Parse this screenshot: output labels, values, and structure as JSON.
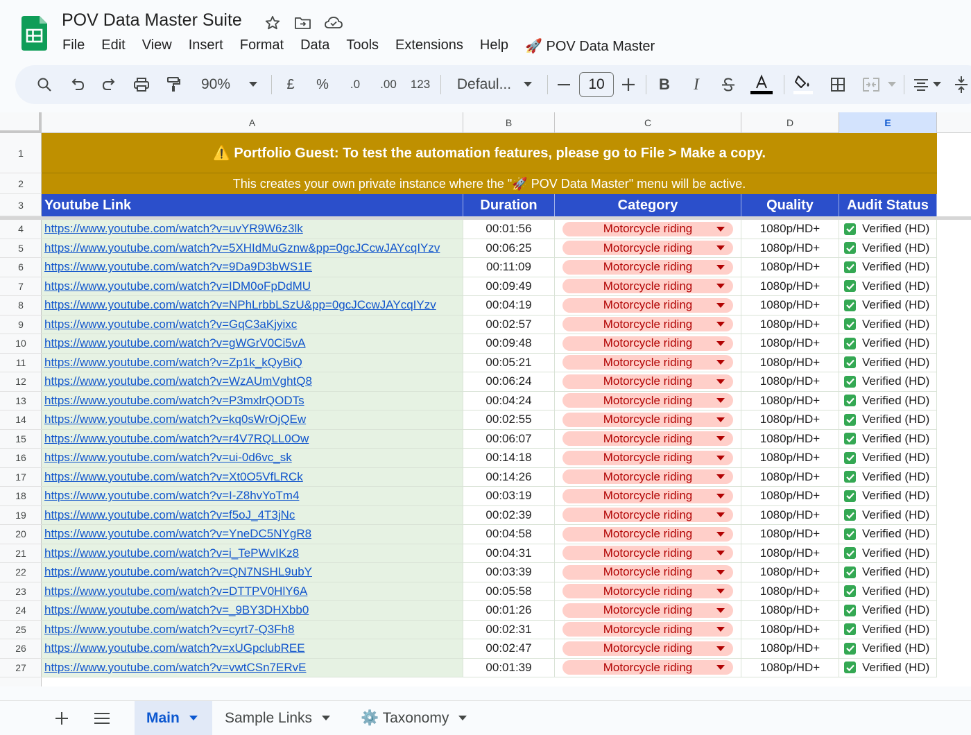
{
  "doc": {
    "title": "POV Data Master Suite"
  },
  "menu": [
    "File",
    "Edit",
    "View",
    "Insert",
    "Format",
    "Data",
    "Tools",
    "Extensions",
    "Help",
    "🚀 POV Data Master"
  ],
  "toolbar": {
    "zoom": "90%",
    "currency": "£",
    "percent": "%",
    "dec_decrease": ".0",
    "dec_increase": ".00",
    "number_format": "123",
    "font": "Defaul...",
    "font_size": "10"
  },
  "grid": {
    "columns": [
      "A",
      "B",
      "C",
      "D",
      "E"
    ],
    "selected_column": "E",
    "banner_line1": "⚠️ Portfolio Guest: To test the automation features, please go to File > Make a copy.",
    "banner_line2": "This creates your own private instance where the \"🚀 POV Data Master\" menu will be active.",
    "headers": [
      "Youtube Link",
      "Duration",
      "Category",
      "Quality",
      "Audit Status"
    ],
    "rows": [
      {
        "n": "4",
        "link": "https://www.youtube.com/watch?v=uvYR9W6z3lk",
        "duration": "00:01:56",
        "category": "Motorcycle riding",
        "quality": "1080p/HD+",
        "status": "Verified (HD)"
      },
      {
        "n": "5",
        "link": "https://www.youtube.com/watch?v=5XHIdMuGznw&pp=0gcJCcwJAYcqIYzv",
        "duration": "00:06:25",
        "category": "Motorcycle riding",
        "quality": "1080p/HD+",
        "status": "Verified (HD)"
      },
      {
        "n": "6",
        "link": "https://www.youtube.com/watch?v=9Da9D3bWS1E",
        "duration": "00:11:09",
        "category": "Motorcycle riding",
        "quality": "1080p/HD+",
        "status": "Verified (HD)"
      },
      {
        "n": "7",
        "link": "https://www.youtube.com/watch?v=IDM0oFpDdMU",
        "duration": "00:09:49",
        "category": "Motorcycle riding",
        "quality": "1080p/HD+",
        "status": "Verified (HD)"
      },
      {
        "n": "8",
        "link": "https://www.youtube.com/watch?v=NPhLrbbLSzU&pp=0gcJCcwJAYcqIYzv",
        "duration": "00:04:19",
        "category": "Motorcycle riding",
        "quality": "1080p/HD+",
        "status": "Verified (HD)"
      },
      {
        "n": "9",
        "link": "https://www.youtube.com/watch?v=GqC3aKjyixc",
        "duration": "00:02:57",
        "category": "Motorcycle riding",
        "quality": "1080p/HD+",
        "status": "Verified (HD)"
      },
      {
        "n": "10",
        "link": "https://www.youtube.com/watch?v=gWGrV0Ci5vA",
        "duration": "00:09:48",
        "category": "Motorcycle riding",
        "quality": "1080p/HD+",
        "status": "Verified (HD)"
      },
      {
        "n": "11",
        "link": "https://www.youtube.com/watch?v=Zp1k_kQyBiQ",
        "duration": "00:05:21",
        "category": "Motorcycle riding",
        "quality": "1080p/HD+",
        "status": "Verified (HD)"
      },
      {
        "n": "12",
        "link": "https://www.youtube.com/watch?v=WzAUmVghtQ8",
        "duration": "00:06:24",
        "category": "Motorcycle riding",
        "quality": "1080p/HD+",
        "status": "Verified (HD)"
      },
      {
        "n": "13",
        "link": "https://www.youtube.com/watch?v=P3mxlrQODTs",
        "duration": "00:04:24",
        "category": "Motorcycle riding",
        "quality": "1080p/HD+",
        "status": "Verified (HD)"
      },
      {
        "n": "14",
        "link": "https://www.youtube.com/watch?v=kq0sWrOjQEw",
        "duration": "00:02:55",
        "category": "Motorcycle riding",
        "quality": "1080p/HD+",
        "status": "Verified (HD)"
      },
      {
        "n": "15",
        "link": "https://www.youtube.com/watch?v=r4V7RQLL0Ow",
        "duration": "00:06:07",
        "category": "Motorcycle riding",
        "quality": "1080p/HD+",
        "status": "Verified (HD)"
      },
      {
        "n": "16",
        "link": "https://www.youtube.com/watch?v=ui-0d6vc_sk",
        "duration": "00:14:18",
        "category": "Motorcycle riding",
        "quality": "1080p/HD+",
        "status": "Verified (HD)"
      },
      {
        "n": "17",
        "link": "https://www.youtube.com/watch?v=Xt0O5VfLRCk",
        "duration": "00:14:26",
        "category": "Motorcycle riding",
        "quality": "1080p/HD+",
        "status": "Verified (HD)"
      },
      {
        "n": "18",
        "link": "https://www.youtube.com/watch?v=I-Z8hvYoTm4",
        "duration": "00:03:19",
        "category": "Motorcycle riding",
        "quality": "1080p/HD+",
        "status": "Verified (HD)"
      },
      {
        "n": "19",
        "link": "https://www.youtube.com/watch?v=f5oJ_4T3jNc",
        "duration": "00:02:39",
        "category": "Motorcycle riding",
        "quality": "1080p/HD+",
        "status": "Verified (HD)"
      },
      {
        "n": "20",
        "link": "https://www.youtube.com/watch?v=YneDC5NYgR8",
        "duration": "00:04:58",
        "category": "Motorcycle riding",
        "quality": "1080p/HD+",
        "status": "Verified (HD)"
      },
      {
        "n": "21",
        "link": "https://www.youtube.com/watch?v=i_TePWvIKz8",
        "duration": "00:04:31",
        "category": "Motorcycle riding",
        "quality": "1080p/HD+",
        "status": "Verified (HD)"
      },
      {
        "n": "22",
        "link": "https://www.youtube.com/watch?v=QN7NSHL9ubY",
        "duration": "00:03:39",
        "category": "Motorcycle riding",
        "quality": "1080p/HD+",
        "status": "Verified (HD)"
      },
      {
        "n": "23",
        "link": "https://www.youtube.com/watch?v=DTTPV0HlY6A",
        "duration": "00:05:58",
        "category": "Motorcycle riding",
        "quality": "1080p/HD+",
        "status": "Verified (HD)"
      },
      {
        "n": "24",
        "link": "https://www.youtube.com/watch?v=_9BY3DHXbb0",
        "duration": "00:01:26",
        "category": "Motorcycle riding",
        "quality": "1080p/HD+",
        "status": "Verified (HD)"
      },
      {
        "n": "25",
        "link": "https://www.youtube.com/watch?v=cyrt7-Q3Fh8",
        "duration": "00:02:31",
        "category": "Motorcycle riding",
        "quality": "1080p/HD+",
        "status": "Verified (HD)"
      },
      {
        "n": "26",
        "link": "https://www.youtube.com/watch?v=xUGpclubREE",
        "duration": "00:02:47",
        "category": "Motorcycle riding",
        "quality": "1080p/HD+",
        "status": "Verified (HD)"
      },
      {
        "n": "27",
        "link": "https://www.youtube.com/watch?v=vwtCSn7ERvE",
        "duration": "00:01:39",
        "category": "Motorcycle riding",
        "quality": "1080p/HD+",
        "status": "Verified (HD)"
      }
    ]
  },
  "sheets": {
    "tabs": [
      "Main",
      "Sample Links",
      "⚙️ Taxonomy"
    ],
    "active": "Main"
  },
  "colors": {
    "banner": "#bf9000",
    "header": "#2b4fcb",
    "link_bg": "#e6f2e3",
    "chip_bg": "#ffcfc9",
    "chip_text": "#b10202",
    "link": "#1155cc",
    "check": "#34a853"
  }
}
